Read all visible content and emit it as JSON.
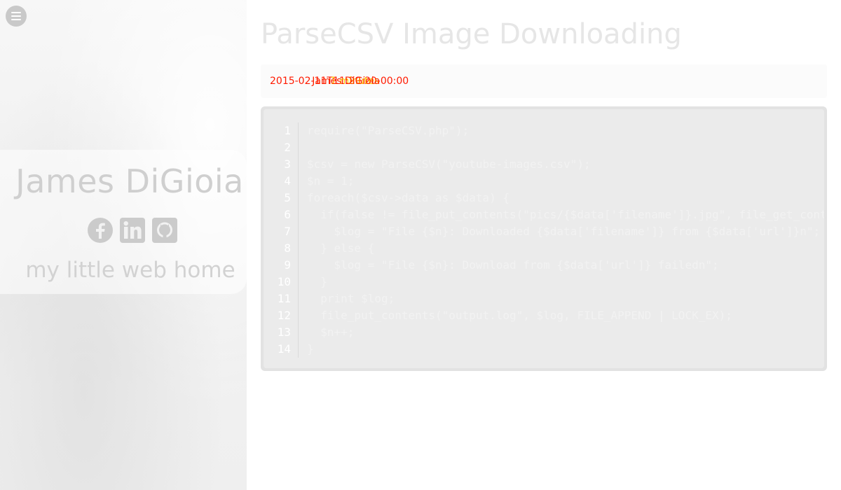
{
  "sidebar": {
    "name": "James DiGioia",
    "tagline": "my little web home",
    "icons": [
      "menu-icon",
      "facebook-icon",
      "linkedin-icon",
      "github-icon"
    ]
  },
  "main": {
    "title": "ParseCSV Image Downloading",
    "meta": {
      "date_text": "2015-02-11T11:29:20-00:00",
      "author_text": "James DiGioia",
      "overlay_text": "1 minutes"
    },
    "code": {
      "line_numbers": [
        "1",
        "2",
        "3",
        "4",
        "5",
        "6",
        "7",
        "8",
        "9",
        "10",
        "11",
        "12",
        "13",
        "14"
      ],
      "lines": [
        "require(\"ParseCSV.php\");",
        "",
        "$csv = new ParseCSV(\"youtube-images.csv\");",
        "$n = 1;",
        "foreach($csv->data as $data) {",
        "  if(false != file_put_contents(\"pics/{$data['filename']}.jpg\", file_get_contents($data['url']))) {",
        "    $log = \"File {$n}: Downloaded {$data['filename']} from {$data['url']}n\";",
        "  } else {",
        "    $log = \"File {$n}: Download from {$data['url']} failedn\";",
        "  }",
        "  print $log;",
        "  file_put_contents(\"output.log\", $log, FILE_APPEND | LOCK_EX);",
        "  $n++;",
        "}"
      ]
    }
  },
  "colors": {
    "sidebar_bg": "#f0f0f0",
    "code_bg": "#ebebeb",
    "meta_red": "#ff1a00",
    "meta_yellow": "#ffd200"
  }
}
